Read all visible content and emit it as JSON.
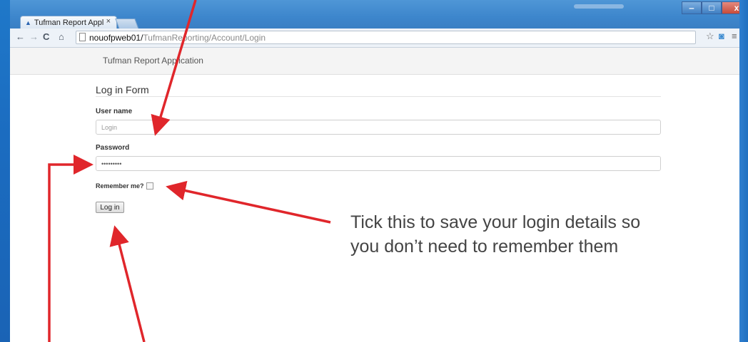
{
  "tab": {
    "title": "Tufman Report Appl",
    "close": "×"
  },
  "window_controls": {
    "minimize": "‒",
    "maximize": "□",
    "close": "x"
  },
  "toolbar": {
    "back": "←",
    "forward": "→",
    "reload": "C",
    "home": "⌂",
    "url_host": "nouofpweb01/",
    "url_path": "TufmanReporting/Account/Login",
    "icons": [
      "star-icon",
      "camera-icon",
      "menu-icon"
    ]
  },
  "app": {
    "name": "Tufman Report Application"
  },
  "form": {
    "title": "Log in Form",
    "username_label": "User name",
    "username_placeholder": "Login",
    "password_label": "Password",
    "password_value": "•••••••••",
    "remember_label": "Remember me?",
    "remember_checked": false,
    "submit_label": "Log in"
  },
  "annotation": {
    "text": "Tick this to save your login details so you don’t need to remember them",
    "arrow_color": "#e0262b"
  }
}
